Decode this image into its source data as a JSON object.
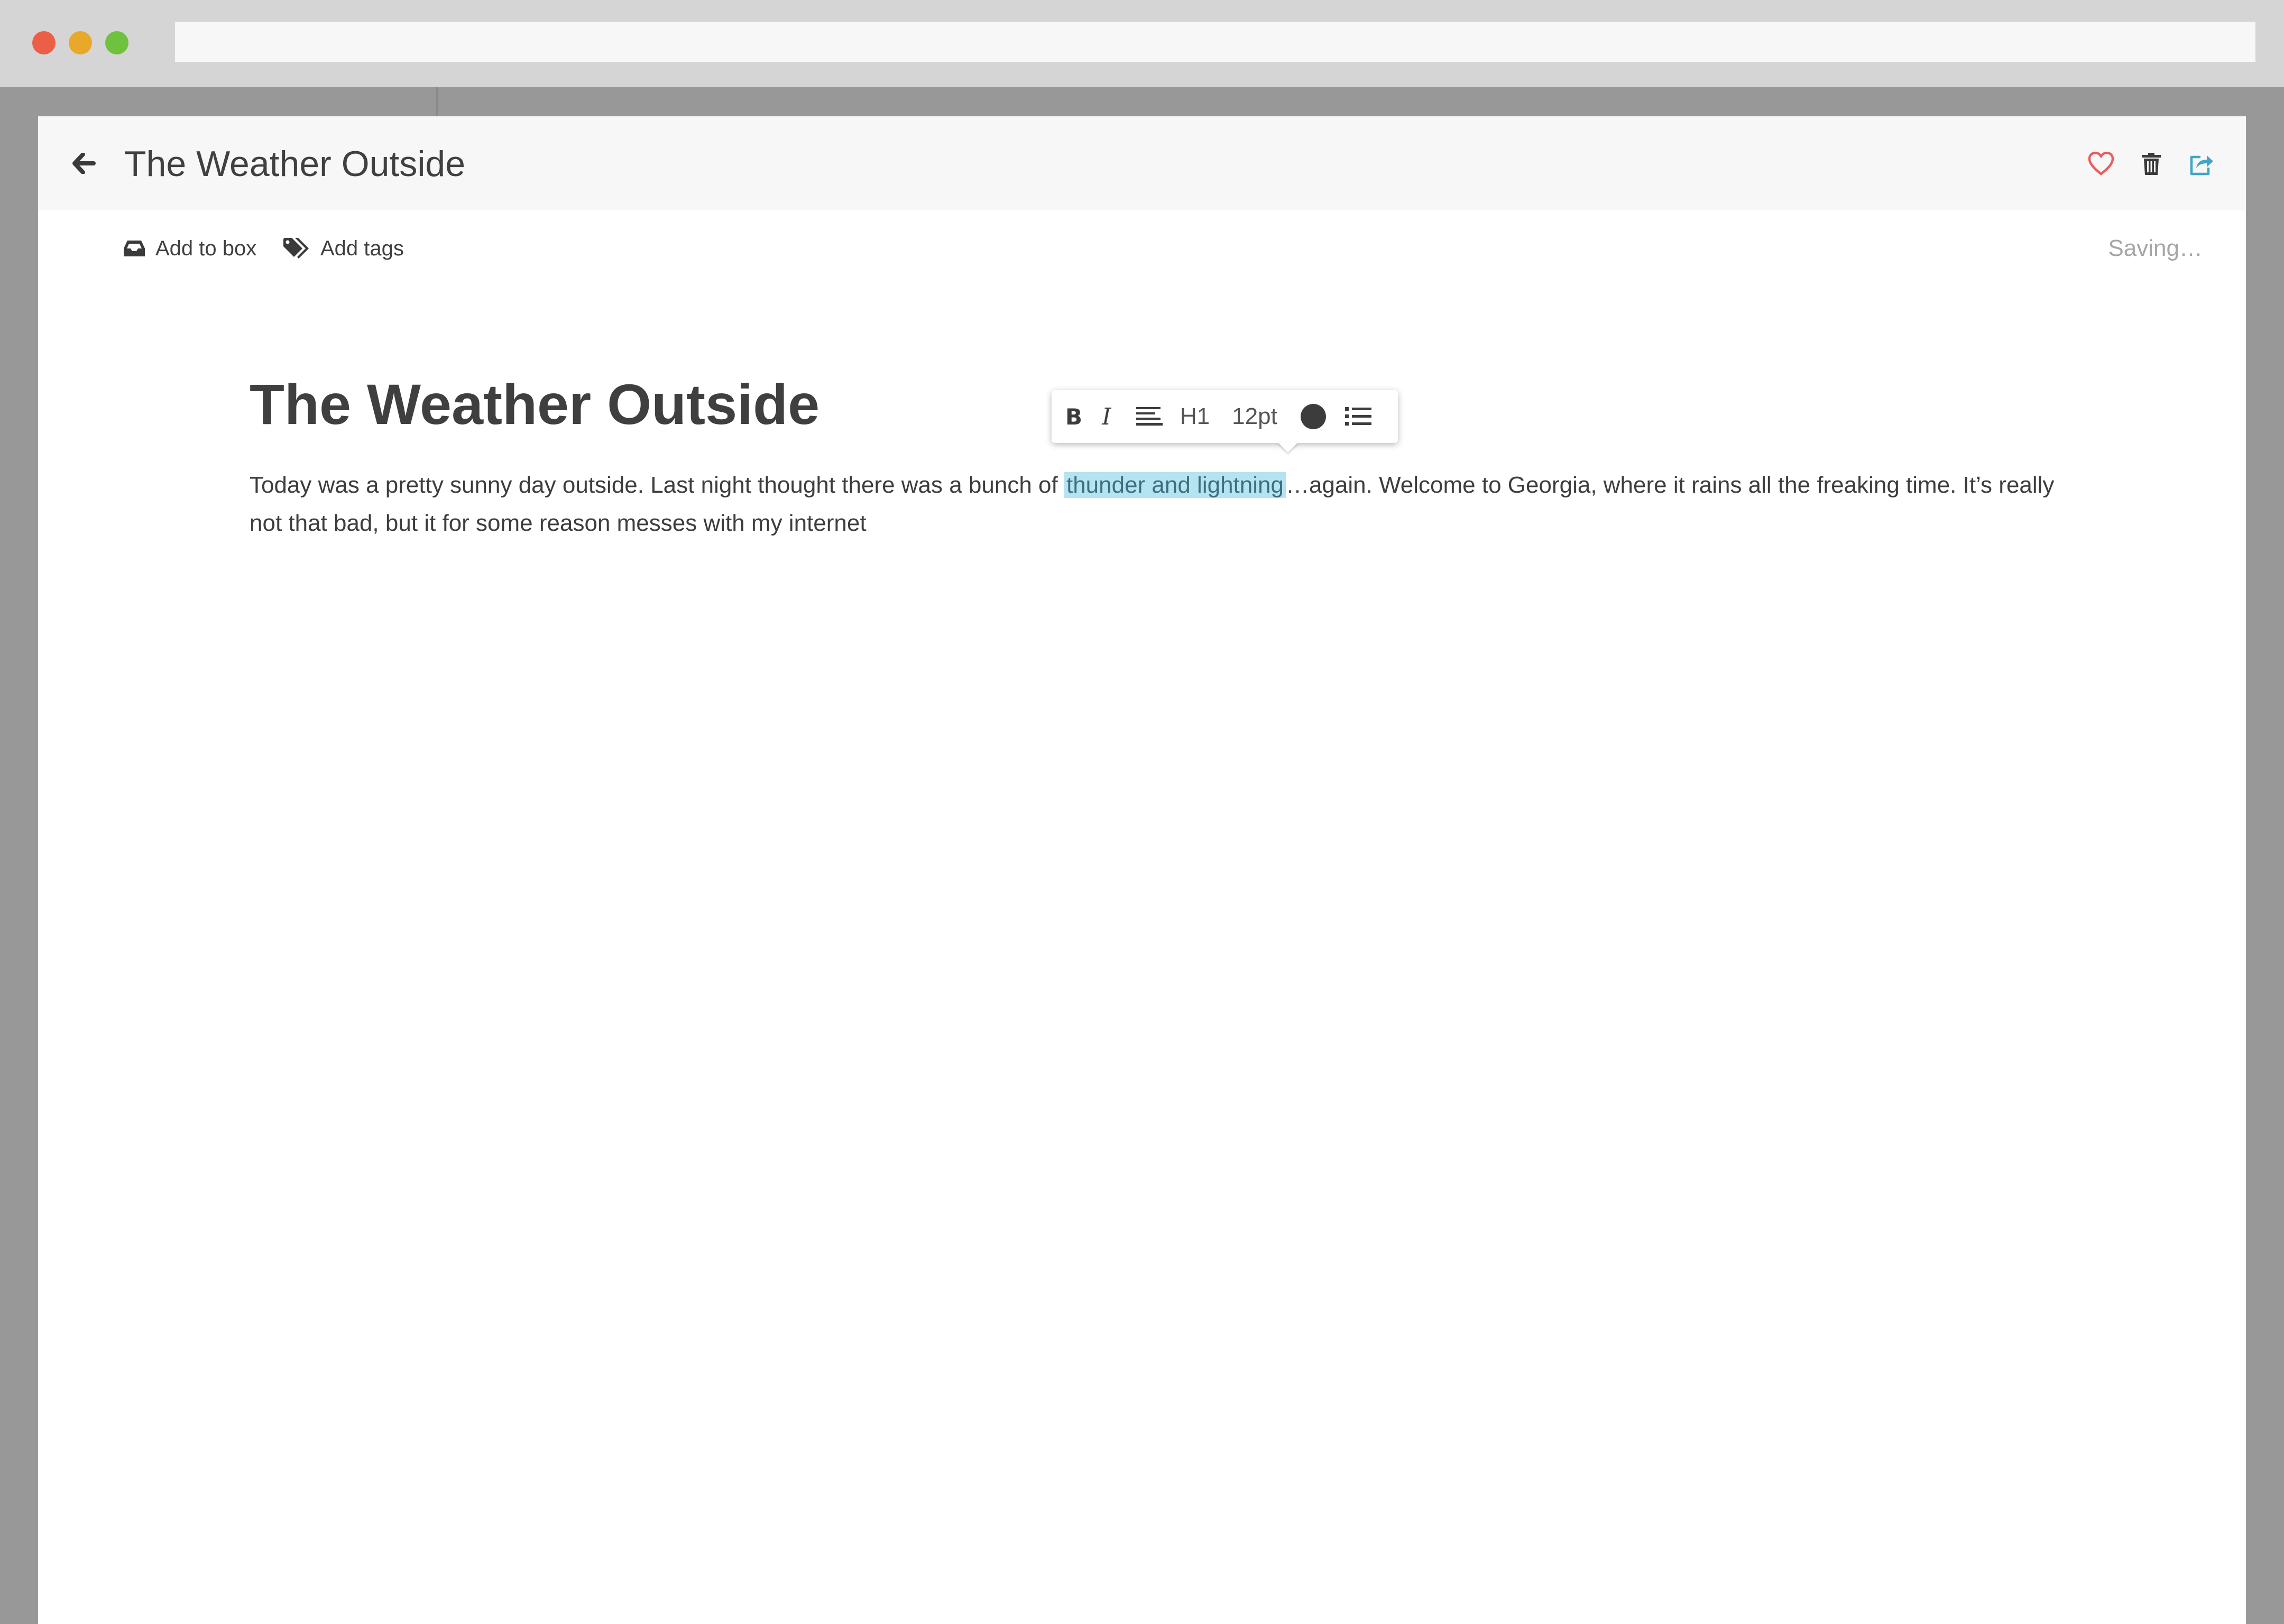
{
  "browser": {
    "url": ""
  },
  "header": {
    "title": "The Weather Outside",
    "icons": {
      "back": "arrow-left-icon",
      "favorite": "heart-icon",
      "delete": "trash-icon",
      "share": "share-icon"
    }
  },
  "subbar": {
    "add_to_box": "Add to box",
    "add_tags": "Add tags",
    "status": "Saving…"
  },
  "toolbar": {
    "bold": "B",
    "italic": "I",
    "heading": "H1",
    "font_size": "12pt",
    "color": "#3c3c3c"
  },
  "document": {
    "title": "The Weather Outside",
    "body_before": "Today was a pretty sunny day outside. Last night thought there was a bunch of ",
    "body_selected": "thunder and lightning",
    "body_after": "…again. Welcome to Georgia, where it rains all the freaking time. It’s really not that bad, but it for some reason messes with my internet"
  },
  "colors": {
    "heart": "#e85c5c",
    "share": "#3ea6c9",
    "selection": "#b5e3f0"
  }
}
